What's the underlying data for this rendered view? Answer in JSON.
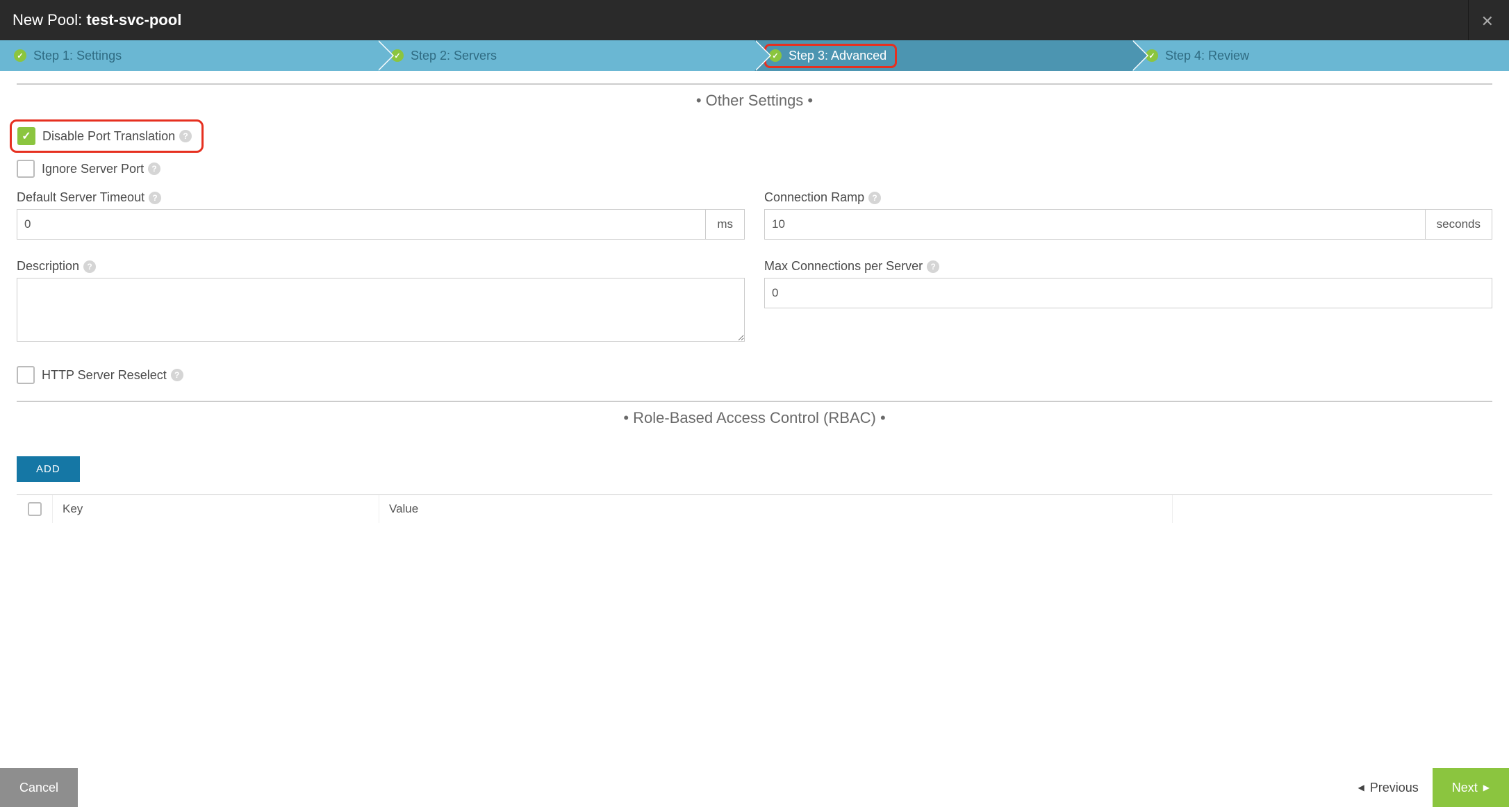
{
  "header": {
    "prefix": "New Pool: ",
    "name": "test-svc-pool"
  },
  "steps": [
    {
      "label": "Step 1: Settings"
    },
    {
      "label": "Step 2: Servers"
    },
    {
      "label": "Step 3: Advanced"
    },
    {
      "label": "Step 4: Review"
    }
  ],
  "sections": {
    "other_settings": "Other Settings",
    "rbac": "Role-Based Access Control (RBAC)"
  },
  "fields": {
    "disable_port_translation": {
      "label": "Disable Port Translation",
      "checked": true
    },
    "ignore_server_port": {
      "label": "Ignore Server Port",
      "checked": false
    },
    "default_server_timeout": {
      "label": "Default Server Timeout",
      "value": "0",
      "unit": "ms"
    },
    "connection_ramp": {
      "label": "Connection Ramp",
      "value": "10",
      "unit": "seconds"
    },
    "description": {
      "label": "Description",
      "value": ""
    },
    "max_conn_per_server": {
      "label": "Max Connections per Server",
      "value": "0"
    },
    "http_server_reselect": {
      "label": "HTTP Server Reselect",
      "checked": false
    }
  },
  "buttons": {
    "add": "ADD",
    "cancel": "Cancel",
    "previous": "Previous",
    "next": "Next"
  },
  "table": {
    "columns": [
      "Key",
      "Value"
    ]
  }
}
